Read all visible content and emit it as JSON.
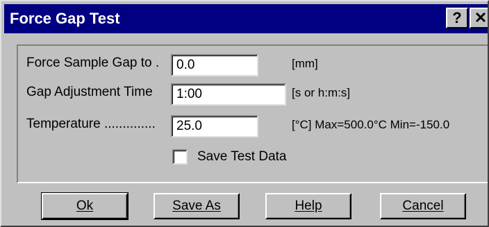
{
  "window": {
    "title": "Force Gap Test",
    "help_button": "?",
    "close_button": "✕"
  },
  "form": {
    "force_gap": {
      "label": "Force Sample Gap to .",
      "value": "0.0",
      "unit": "[mm]"
    },
    "gap_time": {
      "label": "Gap Adjustment Time",
      "value": "1:00",
      "unit": "[s or h:m:s]"
    },
    "temperature": {
      "label": "Temperature ..............",
      "value": "25.0",
      "unit": "[°C] Max=500.0°C  Min=-150.0"
    },
    "save_test_data": {
      "label": "Save Test Data",
      "checked": false
    }
  },
  "buttons": {
    "ok": "Ok",
    "save_as": "Save As",
    "help": "Help",
    "cancel": "Cancel"
  }
}
